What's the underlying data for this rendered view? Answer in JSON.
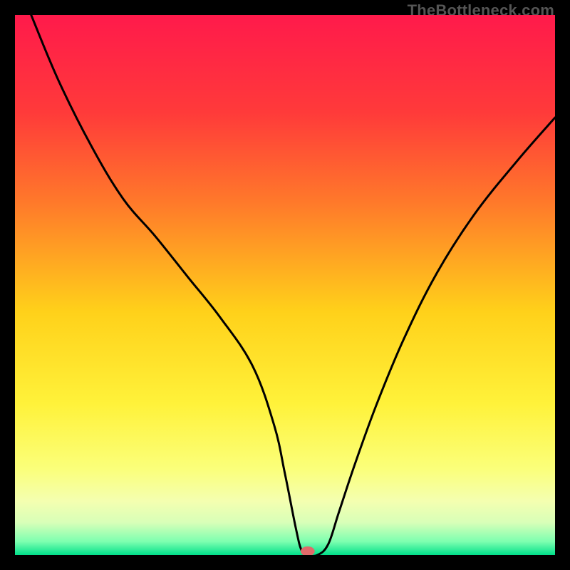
{
  "watermark": "TheBottleneck.com",
  "chart_data": {
    "type": "line",
    "title": "",
    "xlabel": "",
    "ylabel": "",
    "xlim": [
      0,
      100
    ],
    "ylim": [
      0,
      100
    ],
    "grid": false,
    "legend": false,
    "background_gradient_stops": [
      {
        "offset": 0.0,
        "color": "#ff1a4b"
      },
      {
        "offset": 0.18,
        "color": "#ff3a3a"
      },
      {
        "offset": 0.35,
        "color": "#ff7a2a"
      },
      {
        "offset": 0.55,
        "color": "#ffd11a"
      },
      {
        "offset": 0.72,
        "color": "#fff23a"
      },
      {
        "offset": 0.84,
        "color": "#fbff7a"
      },
      {
        "offset": 0.9,
        "color": "#f4ffb0"
      },
      {
        "offset": 0.94,
        "color": "#d8ffb8"
      },
      {
        "offset": 0.975,
        "color": "#7dffb0"
      },
      {
        "offset": 1.0,
        "color": "#00e08a"
      }
    ],
    "series": [
      {
        "name": "bottleneck-curve",
        "stroke": "#000000",
        "stroke_width": 3,
        "x": [
          3,
          8,
          14,
          20,
          26,
          32,
          38,
          44,
          48,
          50,
          52,
          53,
          54,
          56,
          58,
          60,
          63,
          67,
          72,
          78,
          85,
          93,
          100
        ],
        "values": [
          100,
          88,
          76,
          66,
          59,
          51.5,
          44,
          35,
          24,
          15,
          5,
          1,
          0,
          0,
          2,
          8,
          17,
          28,
          40,
          52,
          63,
          73,
          81
        ]
      }
    ],
    "marker": {
      "name": "current-config-marker",
      "x": 54.2,
      "y": 0.7,
      "rx": 1.3,
      "ry": 0.9,
      "fill": "#e06a6a"
    }
  }
}
